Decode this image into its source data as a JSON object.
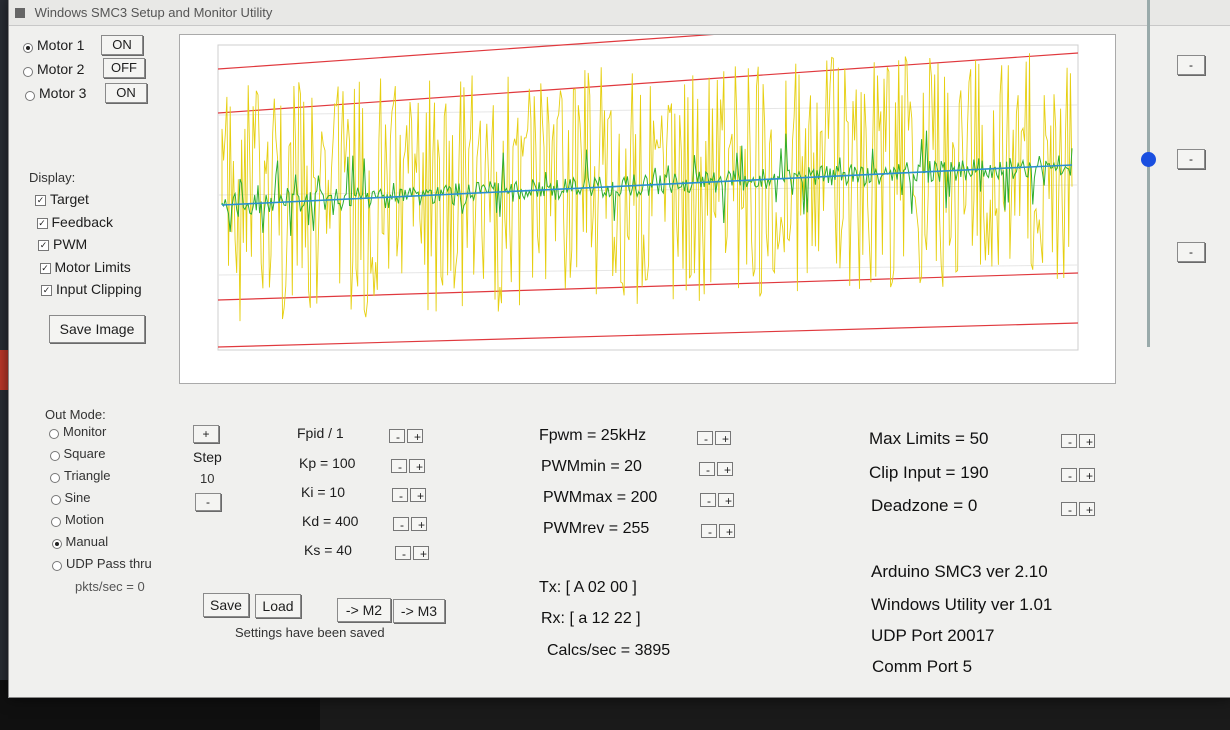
{
  "window": {
    "title": "Windows SMC3 Setup and Monitor Utility"
  },
  "motors": [
    {
      "label": "Motor 1",
      "button": "ON",
      "selected": true
    },
    {
      "label": "Motor 2",
      "button": "OFF",
      "selected": false
    },
    {
      "label": "Motor 3",
      "button": "ON",
      "selected": false
    }
  ],
  "display": {
    "heading": "Display:",
    "options": [
      {
        "label": "Target",
        "checked": true
      },
      {
        "label": "Feedback",
        "checked": true
      },
      {
        "label": "PWM",
        "checked": true
      },
      {
        "label": "Motor Limits",
        "checked": true
      },
      {
        "label": "Input Clipping",
        "checked": true
      }
    ],
    "save_image": "Save Image"
  },
  "out_mode": {
    "heading": "Out Mode:",
    "options": [
      {
        "label": "Monitor",
        "selected": false
      },
      {
        "label": "Square",
        "selected": false
      },
      {
        "label": "Triangle",
        "selected": false
      },
      {
        "label": "Sine",
        "selected": false
      },
      {
        "label": "Motion",
        "selected": false
      },
      {
        "label": "Manual",
        "selected": true
      },
      {
        "label": "UDP Pass thru",
        "selected": false
      }
    ],
    "pkts": "pkts/sec = 0"
  },
  "step": {
    "plus": "+",
    "label": "Step",
    "value": "10",
    "minus": "-"
  },
  "pid": [
    {
      "label": "Fpid / 1"
    },
    {
      "label": "Kp = 100"
    },
    {
      "label": "Ki = 10"
    },
    {
      "label": "Kd = 400"
    },
    {
      "label": "Ks = 40"
    }
  ],
  "pwm": [
    {
      "label": "Fpwm = 25kHz"
    },
    {
      "label": "PWMmin = 20"
    },
    {
      "label": "PWMmax = 200"
    },
    {
      "label": "PWMrev = 255"
    }
  ],
  "limits": [
    {
      "label": "Max Limits = 50"
    },
    {
      "label": "Clip Input = 190"
    },
    {
      "label": "Deadzone = 0"
    }
  ],
  "actions": {
    "save": "Save",
    "load": "Load",
    "to_m2": "-> M2",
    "to_m3": "-> M3",
    "status": "Settings have been saved"
  },
  "comms": {
    "tx": "Tx: [ A 02 00 ]",
    "rx": "Rx: [ a 12 22 ]",
    "calcs": "Calcs/sec = 3895"
  },
  "info": {
    "arduino": "Arduino SMC3 ver 2.10",
    "utility": "Windows Utility ver 1.01",
    "udp": "UDP Port 20017",
    "comm": "Comm Port 5"
  },
  "side_buttons": [
    "-",
    "-",
    "-"
  ],
  "pm": {
    "minus": "-",
    "plus": "+"
  },
  "colors": {
    "target": "#2a8fd0",
    "feedback": "#2fae2f",
    "pwm": "#e6cf10",
    "limits": "#e0393e"
  },
  "chart_data": {
    "type": "line",
    "series_visible": [
      "target",
      "feedback",
      "pwm",
      "motor limits"
    ],
    "target_start": 512,
    "target_end": 560
  }
}
